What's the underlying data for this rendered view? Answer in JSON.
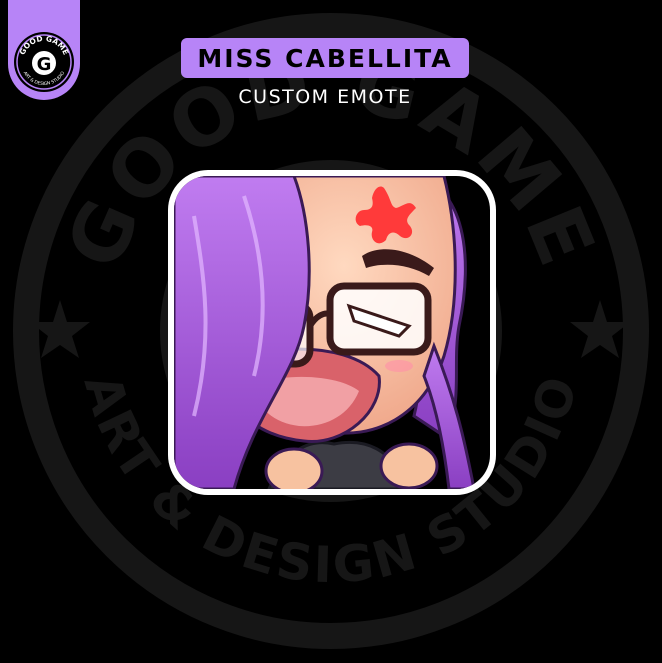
{
  "header": {
    "title": "MISS CABELLITA",
    "subtitle": "CUSTOM EMOTE"
  },
  "badge": {
    "text_top": "GOOD GAME",
    "text_bottom": "ART & DESIGN STUDIO",
    "letter": "G",
    "icon": "studio-logo-badge"
  },
  "watermark": {
    "text_top": "GOOD GAME",
    "text_bottom": "ART & DESIGN STUDIO",
    "icon": "watermark-logo"
  },
  "emote": {
    "icon": "angry-girl-emote-illustration"
  },
  "colors": {
    "background": "#000000",
    "accent": "#b784f7",
    "hair": "#a55ad8",
    "skin": "#f7c2a0",
    "anger_mark": "#ff3a3a",
    "frame": "#ffffff"
  }
}
